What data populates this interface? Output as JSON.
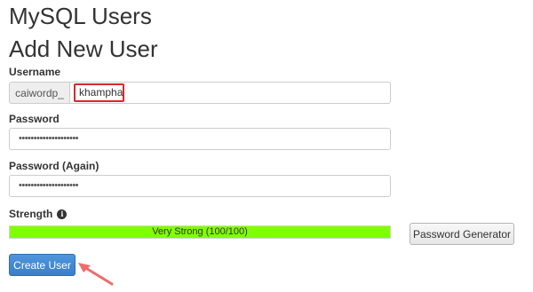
{
  "page": {
    "title": "MySQL Users",
    "section_title": "Add New User"
  },
  "username": {
    "label": "Username",
    "prefix": "caiwordp_",
    "value": "khampha"
  },
  "password": {
    "label": "Password",
    "value": "••••••••••••••••••••"
  },
  "password_again": {
    "label": "Password (Again)",
    "value": "••••••••••••••••••••"
  },
  "strength": {
    "label": "Strength",
    "text": "Very Strong (100/100)",
    "level": 1.0
  },
  "buttons": {
    "password_generator": "Password Generator",
    "create_user": "Create User"
  },
  "colors": {
    "strength_fill": "#80ff00",
    "highlight_border": "#d7282c",
    "primary_button": "#3a7fc8",
    "pointer_arrow": "#f06b6b"
  },
  "icons": {
    "strength_info": "info-icon",
    "annotation": "pointer-arrow-icon"
  }
}
